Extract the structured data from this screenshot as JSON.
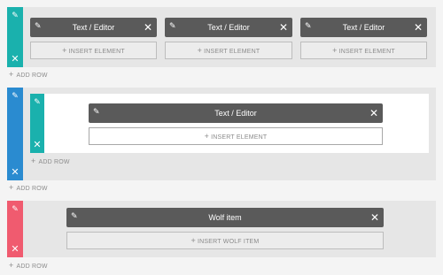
{
  "colors": {
    "teal": "#1ab1ad",
    "blue": "#2a8bd0",
    "coral": "#f05b6f",
    "header": "#5a5a5a"
  },
  "icons": {
    "edit": "✎",
    "close": "✕",
    "plus": "+"
  },
  "row1": {
    "columns": [
      {
        "title": "Text / Editor",
        "insert_label": "INSERT ELEMENT"
      },
      {
        "title": "Text / Editor",
        "insert_label": "INSERT ELEMENT"
      },
      {
        "title": "Text / Editor",
        "insert_label": "INSERT ELEMENT"
      }
    ],
    "add_row_label": "ADD ROW"
  },
  "row2": {
    "inner": {
      "title": "Text / Editor",
      "insert_label": "INSERT ELEMENT",
      "add_row_label": "ADD ROW"
    },
    "add_row_label": "ADD ROW"
  },
  "row3": {
    "title": "Wolf item",
    "insert_label": "INSERT WOLF ITEM",
    "add_row_label": "ADD ROW"
  }
}
